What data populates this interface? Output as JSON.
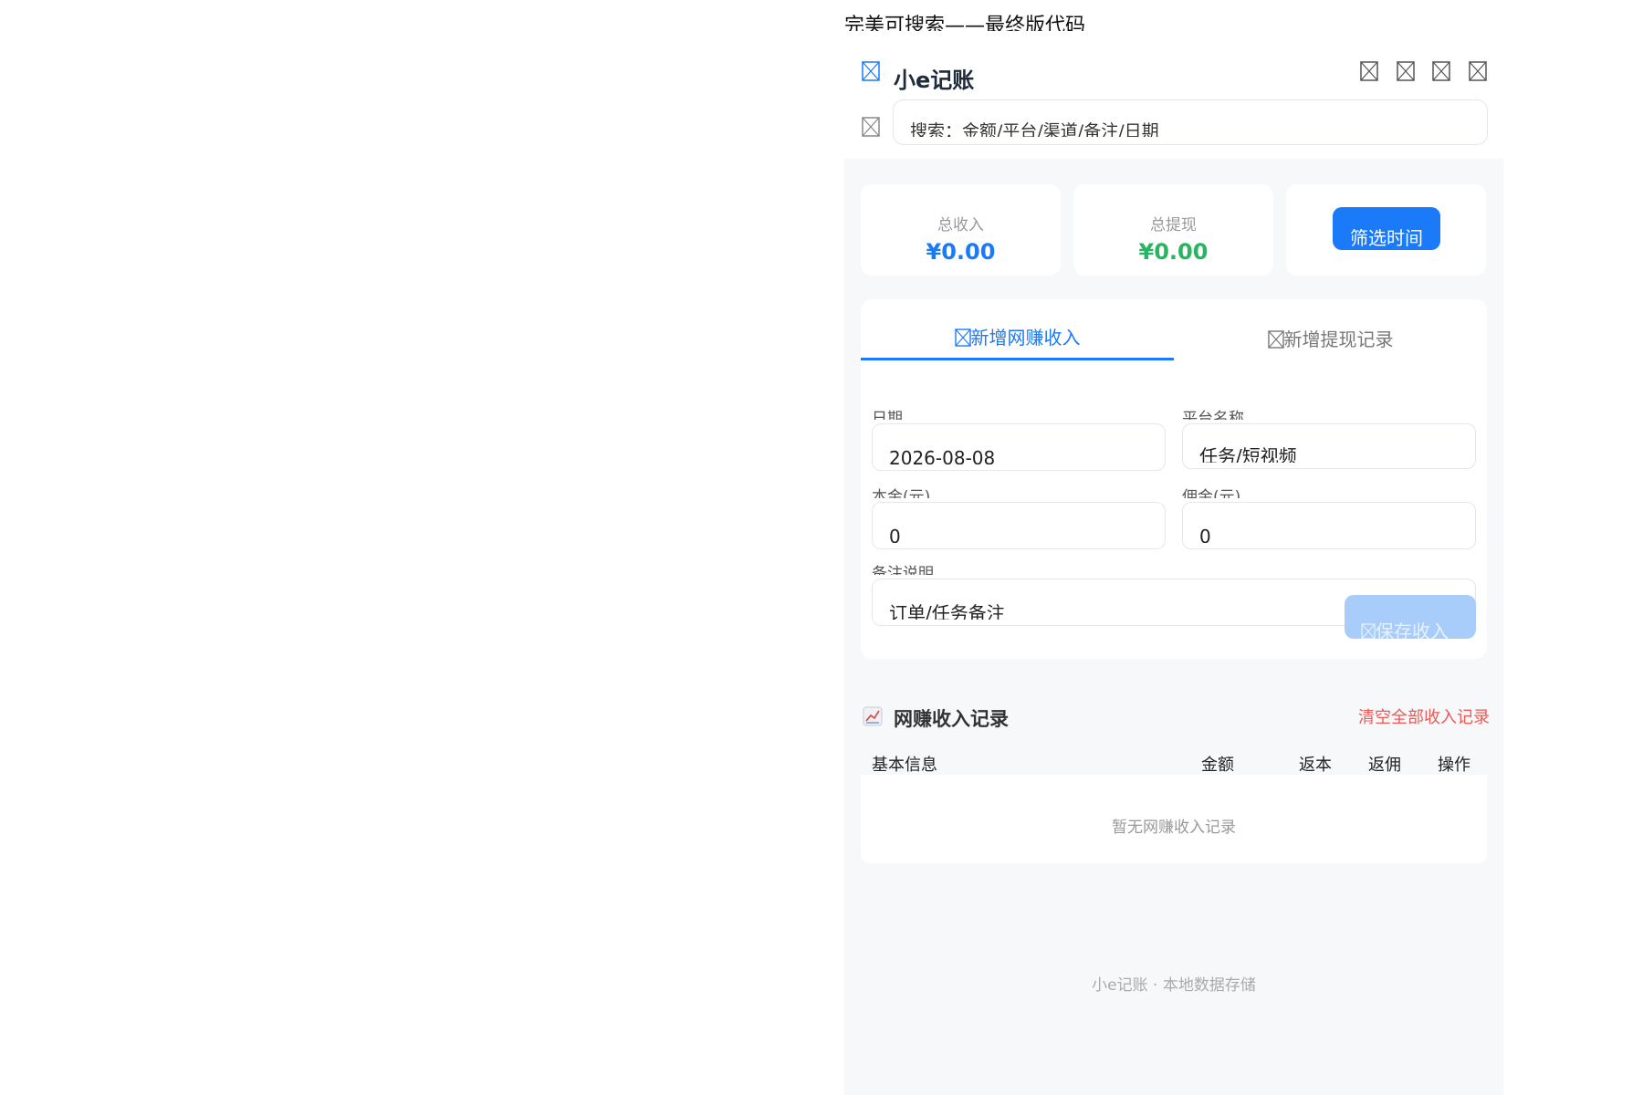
{
  "doc": {
    "title": "完美可搜索——最终版代码"
  },
  "header": {
    "app_title": "小e记账",
    "search": {
      "placeholder": "搜索：金额/平台/渠道/备注/日期"
    },
    "toolbar_icons": [
      "broken-image-icon",
      "broken-image-icon",
      "broken-image-icon",
      "broken-image-icon"
    ]
  },
  "summary": {
    "income": {
      "label": "总收入",
      "value": "¥0.00",
      "color": "#1a7af8"
    },
    "withdraw": {
      "label": "总提现",
      "value": "¥0.00",
      "color": "#27b561"
    },
    "filter_button": "筛选时间"
  },
  "tabs": [
    {
      "label": "新增网赚收入",
      "icon": "broken-image-icon",
      "active": true
    },
    {
      "label": "新增提现记录",
      "icon": "broken-image-icon",
      "active": false
    }
  ],
  "form": {
    "date": {
      "label": "日期",
      "value": "2026-08-08"
    },
    "platform": {
      "label": "平台名称",
      "placeholder": "任务/短视频"
    },
    "principal": {
      "label": "本金(元)",
      "value": "0"
    },
    "commission": {
      "label": "佣金(元)",
      "value": "0"
    },
    "note": {
      "label": "备注说明",
      "placeholder": "订单/任务备注"
    },
    "save_button": "保存收入"
  },
  "records": {
    "title": "网赚收入记录",
    "title_icon": "chart-increasing-icon",
    "clear_link": "清空全部收入记录",
    "columns": [
      "基本信息",
      "金额",
      "返本",
      "返佣",
      "操作"
    ],
    "empty_text": "暂无网赚收入记录"
  },
  "footer": {
    "text": "小e记账 · 本地数据存储"
  },
  "colors": {
    "accent": "#1a7af8",
    "danger": "#ec5a55",
    "success": "#27b561",
    "background": "#f7f8fa"
  }
}
